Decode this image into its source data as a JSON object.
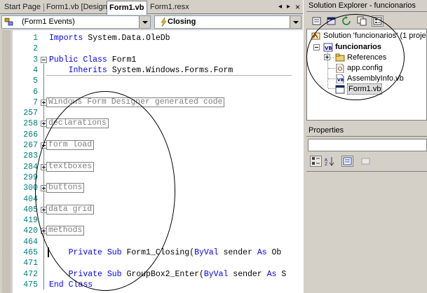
{
  "tabs": [
    {
      "label": "Start Page",
      "active": false
    },
    {
      "label": "Form1.vb [Design]",
      "active": false
    },
    {
      "label": "Form1.vb",
      "active": true
    },
    {
      "label": "Form1.resx",
      "active": false
    }
  ],
  "tab_controls": {
    "left": "◂",
    "right": "▸",
    "close": "×"
  },
  "class_combo": {
    "value": "(Form1 Events)",
    "icon": "events-icon"
  },
  "method_combo": {
    "value": "Closing",
    "icon": "lightning-icon"
  },
  "code_lines": [
    {
      "num": "1",
      "tokens": [
        {
          "t": "Imports",
          "k": 1
        },
        {
          "t": " System.Data.OleDb",
          "k": 0
        }
      ]
    },
    {
      "num": "2",
      "tokens": []
    },
    {
      "num": "3",
      "fold": "minus",
      "tokens": [
        {
          "t": "Public",
          "k": 1
        },
        {
          "t": " ",
          "k": 0
        },
        {
          "t": "Class",
          "k": 1
        },
        {
          "t": " Form1",
          "k": 0
        }
      ]
    },
    {
      "num": "4",
      "tokens": [
        {
          "t": "    ",
          "k": 0
        },
        {
          "t": "Inherits",
          "k": 1
        },
        {
          "t": " System.Windows.Forms.Form",
          "k": 0
        }
      ]
    },
    {
      "num": "5",
      "tokens": []
    },
    {
      "num": "6",
      "tokens": []
    },
    {
      "num": "7",
      "fold": "plus",
      "region": "Windows Form Designer generated code"
    },
    {
      "num": "257",
      "tokens": []
    },
    {
      "num": "258",
      "fold": "plus",
      "region": "declarations"
    },
    {
      "num": "266",
      "tokens": []
    },
    {
      "num": "267",
      "fold": "plus",
      "region": "form load"
    },
    {
      "num": "283",
      "tokens": []
    },
    {
      "num": "284",
      "fold": "plus",
      "region": "textboxes"
    },
    {
      "num": "299",
      "tokens": []
    },
    {
      "num": "300",
      "fold": "plus",
      "region": "buttons"
    },
    {
      "num": "404",
      "tokens": []
    },
    {
      "num": "405",
      "fold": "plus",
      "region": "data grid"
    },
    {
      "num": "419",
      "tokens": []
    },
    {
      "num": "420",
      "fold": "plus",
      "region": "methods"
    },
    {
      "num": "464",
      "tokens": []
    },
    {
      "num": "465",
      "tokens": [
        {
          "t": "    ",
          "k": 0
        },
        {
          "t": "Private",
          "k": 1
        },
        {
          "t": " ",
          "k": 0
        },
        {
          "t": "Sub",
          "k": 1
        },
        {
          "t": " Form1_Closing(",
          "k": 0
        },
        {
          "t": "ByVal",
          "k": 1
        },
        {
          "t": " sender ",
          "k": 0
        },
        {
          "t": "As",
          "k": 1
        },
        {
          "t": " Ob",
          "k": 0
        }
      ]
    },
    {
      "num": "471",
      "tokens": []
    },
    {
      "num": "472",
      "tokens": [
        {
          "t": "    ",
          "k": 0
        },
        {
          "t": "Private",
          "k": 1
        },
        {
          "t": " ",
          "k": 0
        },
        {
          "t": "Sub",
          "k": 1
        },
        {
          "t": " GroupBox2_Enter(",
          "k": 0
        },
        {
          "t": "ByVal",
          "k": 1
        },
        {
          "t": " sender ",
          "k": 0
        },
        {
          "t": "As",
          "k": 1
        },
        {
          "t": " S",
          "k": 0
        }
      ]
    },
    {
      "num": "475",
      "tokens": [
        {
          "t": "End",
          "k": 1
        },
        {
          "t": " ",
          "k": 0
        },
        {
          "t": "Class",
          "k": 1
        }
      ]
    }
  ],
  "solution_explorer": {
    "title": "Solution Explorer - funcionarios",
    "solution_label": "Solution 'funcionarios' (1 project)",
    "project_label": "funcionarios",
    "items": [
      {
        "label": "References",
        "icon": "references-icon"
      },
      {
        "label": "app.config",
        "icon": "config-file-icon"
      },
      {
        "label": "AssemblyInfo.vb",
        "icon": "vb-file-icon"
      },
      {
        "label": "Form1.vb",
        "icon": "form-file-icon"
      }
    ]
  },
  "properties": {
    "title": "Properties"
  }
}
